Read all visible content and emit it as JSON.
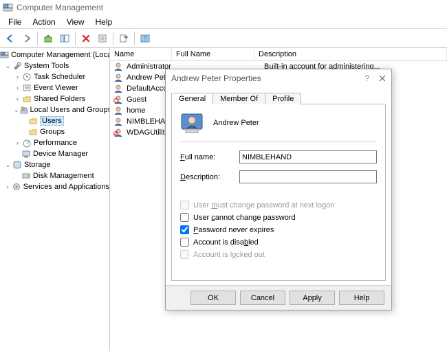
{
  "window": {
    "title": "Computer Management"
  },
  "menu": {
    "file": "File",
    "action": "Action",
    "view": "View",
    "help": "Help"
  },
  "tree": {
    "root": "Computer Management (Local",
    "system_tools": "System Tools",
    "task_scheduler": "Task Scheduler",
    "event_viewer": "Event Viewer",
    "shared_folders": "Shared Folders",
    "local_users": "Local Users and Groups",
    "users": "Users",
    "groups": "Groups",
    "performance": "Performance",
    "device_manager": "Device Manager",
    "storage": "Storage",
    "disk_management": "Disk Management",
    "services": "Services and Applications"
  },
  "list": {
    "headers": {
      "name": "Name",
      "fullname": "Full Name",
      "desc": "Description"
    },
    "rows": [
      {
        "name": "Administrator",
        "fullname": "",
        "desc": "Built-in account for administering..."
      },
      {
        "name": "Andrew Peter",
        "fullname": "",
        "desc": ""
      },
      {
        "name": "DefaultAcco...",
        "fullname": "",
        "desc": ""
      },
      {
        "name": "Guest",
        "fullname": "",
        "desc": ""
      },
      {
        "name": "home",
        "fullname": "",
        "desc": ""
      },
      {
        "name": "NIMBLEHAND",
        "fullname": "",
        "desc": ""
      },
      {
        "name": "WDAGUtility...",
        "fullname": "",
        "desc": ""
      }
    ]
  },
  "dialog": {
    "title": "Andrew Peter Properties",
    "tabs": {
      "general": "General",
      "memberof": "Member Of",
      "profile": "Profile"
    },
    "user_display": "Andrew Peter",
    "fullname_label": "Full name:",
    "fullname_value": "NIMBLEHAND",
    "description_label": "Description:",
    "description_value": "",
    "checks": {
      "must_change": "User must change password at next logon",
      "cannot_change": "User cannot change password",
      "never_expires": "Password never expires",
      "disabled": "Account is disabled",
      "locked": "Account is locked out"
    },
    "buttons": {
      "ok": "OK",
      "cancel": "Cancel",
      "apply": "Apply",
      "help": "Help"
    }
  }
}
